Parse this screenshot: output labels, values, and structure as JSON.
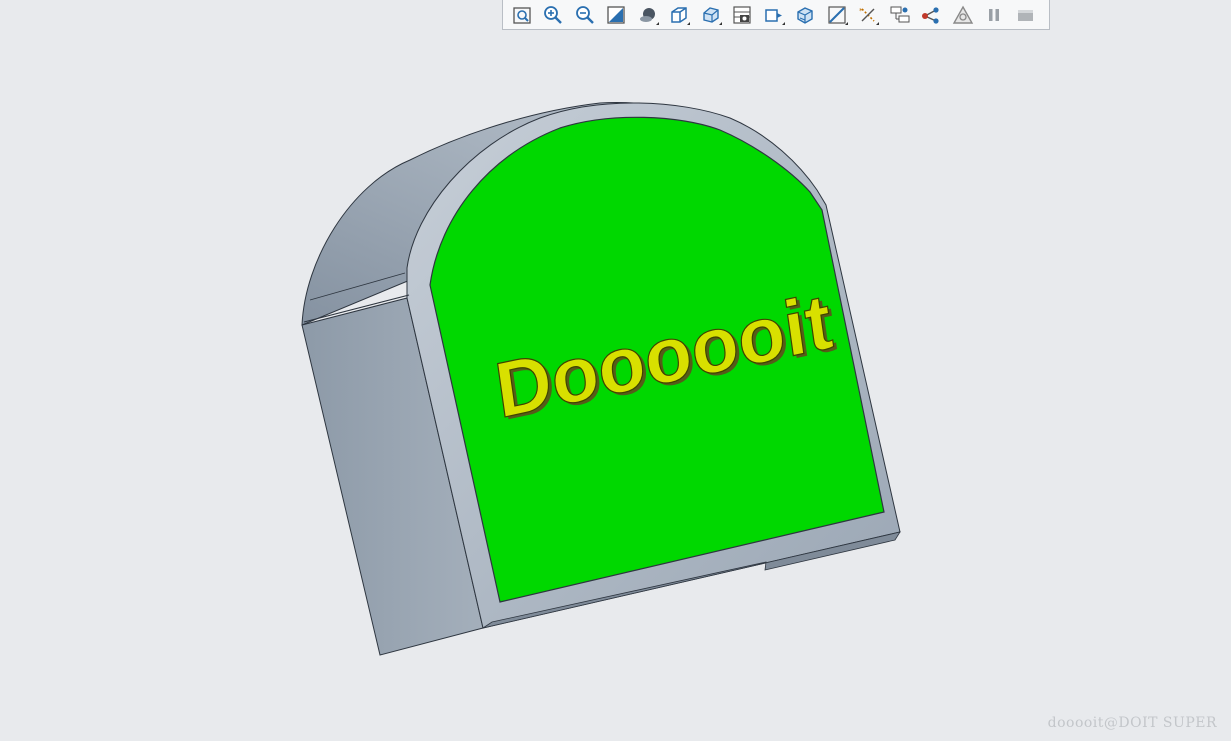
{
  "toolbar": {
    "buttons": [
      {
        "icon": "refit-icon",
        "label": "Refit",
        "menu": false
      },
      {
        "icon": "zoom-in-icon",
        "label": "Zoom In",
        "menu": false
      },
      {
        "icon": "zoom-out-icon",
        "label": "Zoom Out",
        "menu": false
      },
      {
        "icon": "repaint-icon",
        "label": "Repaint",
        "menu": false
      },
      {
        "icon": "display-style-icon",
        "label": "Display Style",
        "menu": true
      },
      {
        "icon": "saved-orientations-icon",
        "label": "Saved Orientations",
        "menu": true
      },
      {
        "icon": "view-manager-icon",
        "label": "View Manager",
        "menu": true
      },
      {
        "icon": "perspective-view-icon",
        "label": "Perspective View",
        "menu": false
      },
      {
        "icon": "section-view-icon",
        "label": "Section",
        "menu": true
      },
      {
        "icon": "shaded-model-icon",
        "label": "Shading",
        "menu": false
      },
      {
        "icon": "datum-display-icon",
        "label": "Datum Display Filters",
        "menu": true
      },
      {
        "icon": "annotation-display-icon",
        "label": "Annotation Display",
        "menu": true
      },
      {
        "icon": "model-tree-icon",
        "label": "Model Tree Filter",
        "menu": false
      },
      {
        "icon": "network-icon",
        "label": "Connections",
        "menu": false
      },
      {
        "icon": "warning-triangle-icon",
        "label": "Spin Center",
        "menu": false
      },
      {
        "icon": "pause-icon",
        "label": "Pause",
        "menu": false
      },
      {
        "icon": "stop-icon",
        "label": "Stop",
        "menu": false
      }
    ]
  },
  "model": {
    "embossed_text": "Doooooit",
    "face_color": "#00d800",
    "text_color": "#d8e000",
    "body_color": "#9aa6b4"
  },
  "watermark": "dooooit@DOIT SUPER"
}
